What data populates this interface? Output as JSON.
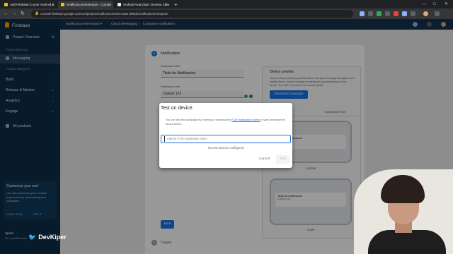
{
  "browser": {
    "tabs": [
      {
        "title": "Add Firebase to your Android p",
        "active": false,
        "color": "#fbbc04"
      },
      {
        "title": "Notificacionesremotas - Compo",
        "active": true,
        "color": "#fbbc04"
      },
      {
        "title": "Android Avanzado: Domina Clea",
        "active": false,
        "color": "#e8eaed"
      }
    ],
    "url": "console.firebase.google.com/u/4/project/notificacionesremotas-db8d1/notification/compose"
  },
  "sidebar": {
    "brand": "Firebase",
    "overview": "Project Overview",
    "shortcuts_header": "Project shortcuts",
    "messaging": "Messaging",
    "categories_header": "Product categories",
    "categories": [
      {
        "label": "Build"
      },
      {
        "label": "Release & Monitor"
      },
      {
        "label": "Analytics"
      },
      {
        "label": "Engage"
      }
    ],
    "all_products": "All products",
    "customize": {
      "title": "Customize your nav!",
      "description": "You can now focus your console experience by customizing your navigation",
      "learn_more": "Learn more",
      "got_it": "Got it"
    },
    "plan": "Spark",
    "plan_detail": "No cost $0/month"
  },
  "topbar": {
    "project": "Notificacionesremotas",
    "crumb1": "Cloud Messaging",
    "crumb2": "Compose notification"
  },
  "compose": {
    "step1_num": "1",
    "step1_title": "Notification",
    "title_label": "Notification title",
    "title_value": "Titulo de Notificacion",
    "text_label": "Notification text",
    "text_value": "Cuerpo 123",
    "next": "Next",
    "step2_num": "2",
    "step2_title": "Target"
  },
  "preview": {
    "title": "Device preview",
    "description": "This preview provides a general idea of how your message will appear on a mobile device. Actual message rendering will vary depending on the device. Test with a real device for actual results.",
    "send_button": "Send test message",
    "tab_initial": "Initial state",
    "tab_expanded": "Expanded view",
    "android_label": "Android",
    "apple_label": "Apple",
    "notif_title": "Titulo de Notificacion",
    "notif_body": "Cuerpo 123"
  },
  "dialog": {
    "title": "Test on device",
    "description_pre": "You can test this campaign by entering or selecting the",
    "link": "FCM registration tokens",
    "description_post": "of your development device below.",
    "placeholder": "Add an FCM registration token",
    "empty": "No test devices configured",
    "cancel": "Cancel",
    "test": "Test"
  },
  "watermark": "DevKiper"
}
